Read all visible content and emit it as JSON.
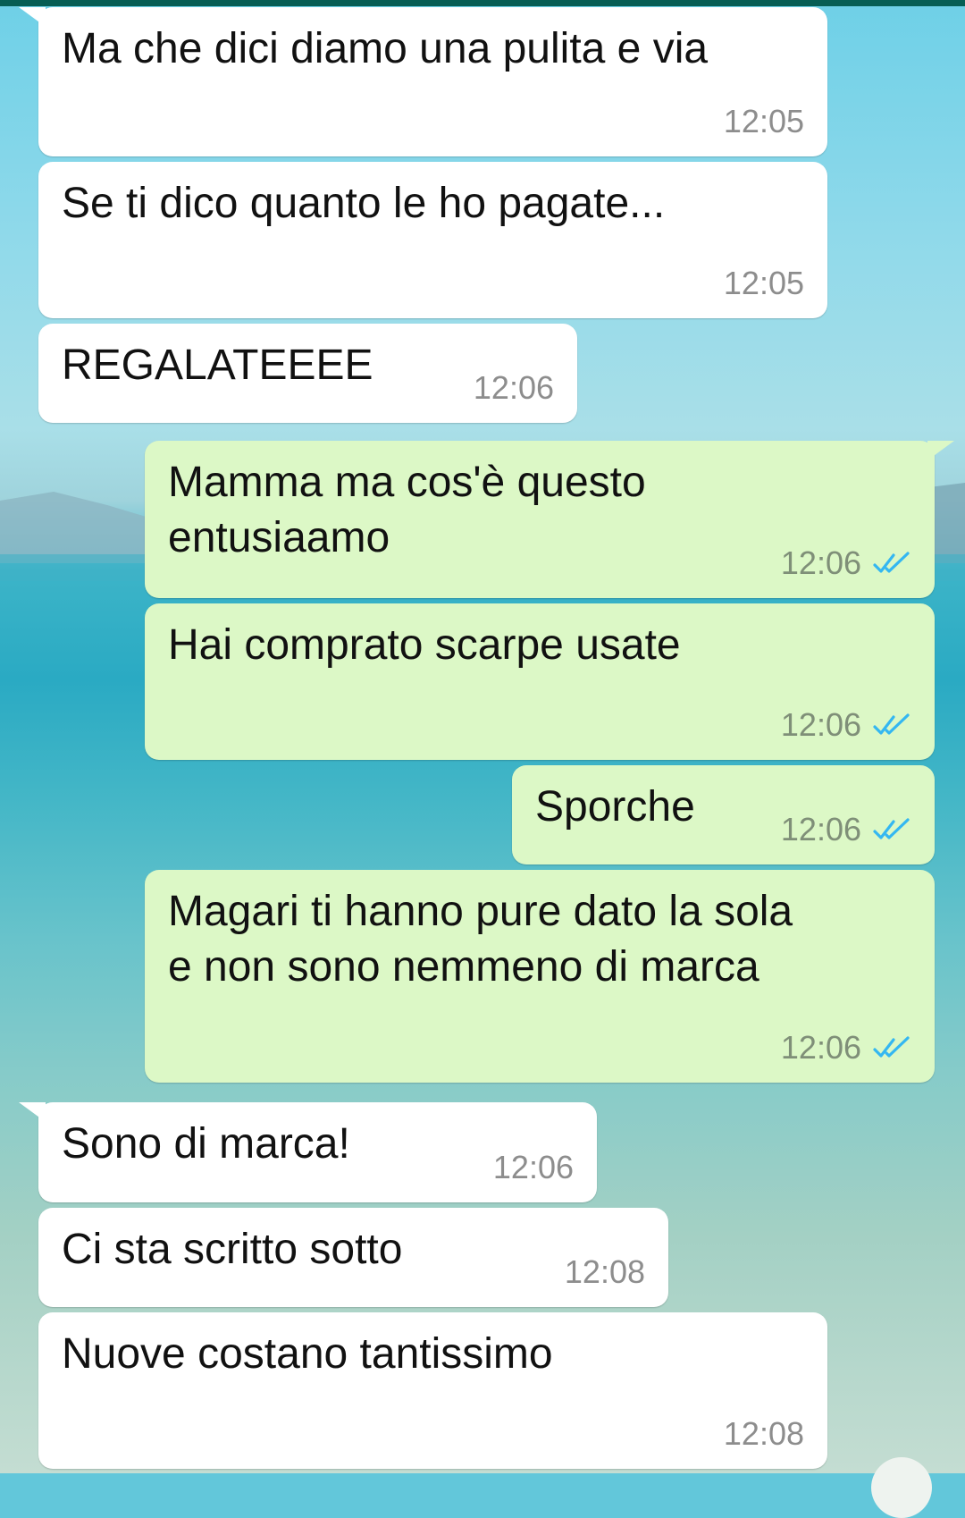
{
  "chat": {
    "messages": [
      {
        "direction": "incoming",
        "text": "Ma che dici diamo una pulita e via",
        "time": "12:05"
      },
      {
        "direction": "incoming",
        "text": "Se ti dico quanto le ho pagate...",
        "time": "12:05"
      },
      {
        "direction": "incoming",
        "text": "REGALATEEEE",
        "time": "12:06"
      },
      {
        "direction": "outgoing",
        "text": "Mamma ma cos'è questo\nentusiaamo",
        "time": "12:06",
        "status": "read"
      },
      {
        "direction": "outgoing",
        "text": "Hai comprato scarpe usate",
        "time": "12:06",
        "status": "read"
      },
      {
        "direction": "outgoing",
        "text": "Sporche",
        "time": "12:06",
        "status": "read"
      },
      {
        "direction": "outgoing",
        "text": "Magari ti hanno pure dato la sola\ne non sono nemmeno di marca",
        "time": "12:06",
        "status": "read"
      },
      {
        "direction": "incoming",
        "text": "Sono di marca!",
        "time": "12:06"
      },
      {
        "direction": "incoming",
        "text": "Ci sta scritto sotto",
        "time": "12:08"
      },
      {
        "direction": "incoming",
        "text": "Nuove costano tantissimo",
        "time": "12:08"
      }
    ]
  },
  "theme": {
    "incoming_bubble": "#ffffff",
    "outgoing_bubble": "#dcf8c6",
    "read_tick": "#34b7f1",
    "header": "#075e54"
  },
  "icons": {
    "read_receipt": "double-check-icon"
  }
}
